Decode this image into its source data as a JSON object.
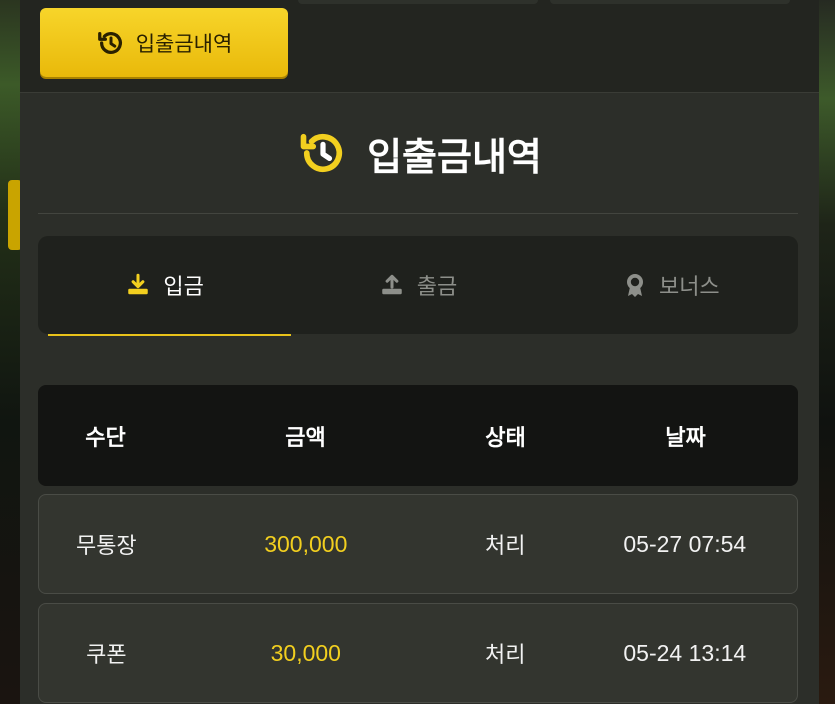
{
  "top_button": {
    "label": "입출금내역",
    "icon": "history-icon"
  },
  "panel": {
    "title": "입출금내역",
    "title_icon": "history-icon"
  },
  "tabs": [
    {
      "label": "입금",
      "icon": "download-icon",
      "active": true
    },
    {
      "label": "출금",
      "icon": "upload-icon",
      "active": false
    },
    {
      "label": "보너스",
      "icon": "award-icon",
      "active": false
    }
  ],
  "table": {
    "headers": [
      "수단",
      "금액",
      "상태",
      "날짜"
    ],
    "rows": [
      {
        "method": "무통장",
        "amount": "300,000",
        "status": "처리",
        "date": "05-27 07:54"
      },
      {
        "method": "쿠폰",
        "amount": "30,000",
        "status": "처리",
        "date": "05-24 13:14"
      }
    ]
  },
  "colors": {
    "accent": "#f2cf1f",
    "panel": "#2c2e29",
    "header": "#131412"
  }
}
